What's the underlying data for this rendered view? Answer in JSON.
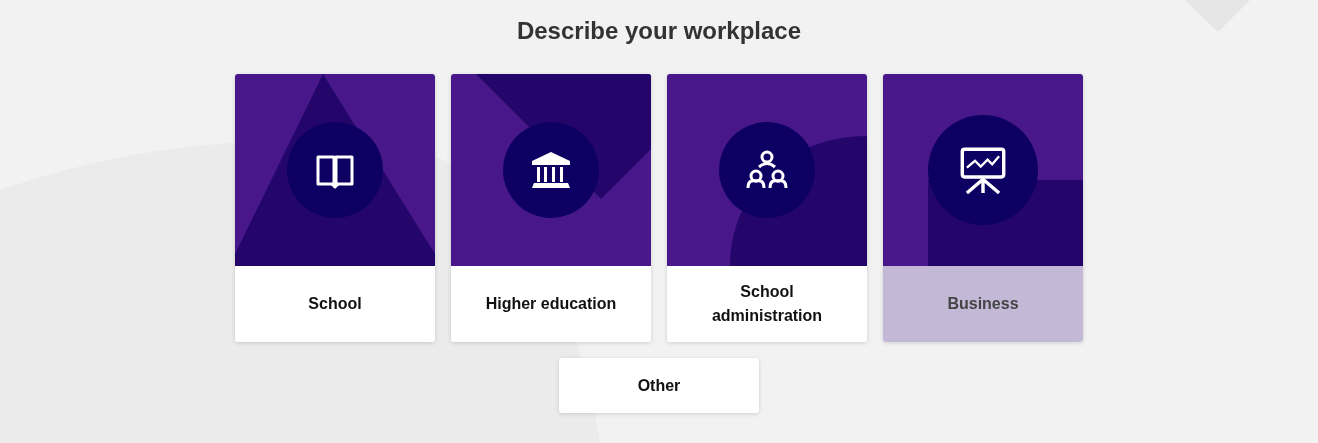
{
  "heading": "Describe your workplace",
  "options": [
    {
      "label": "School",
      "kind": "book",
      "selected": false
    },
    {
      "label": "Higher education",
      "kind": "institution",
      "selected": false
    },
    {
      "label": "School administration",
      "kind": "group",
      "selected": false
    },
    {
      "label": "Business",
      "kind": "presentation",
      "selected": true
    }
  ],
  "other_button": "Other"
}
